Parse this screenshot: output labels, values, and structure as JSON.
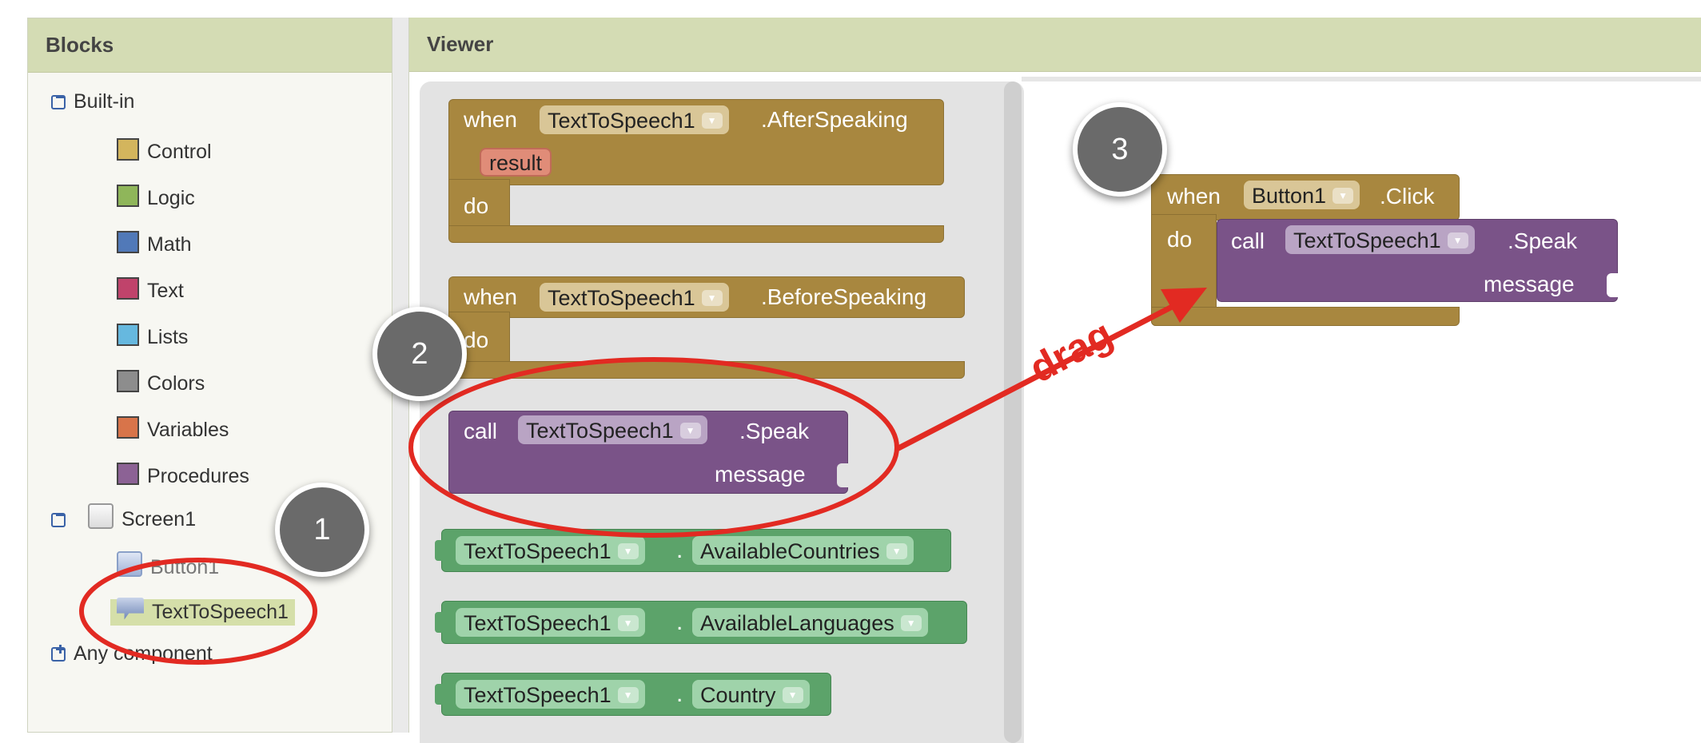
{
  "blocks_panel": {
    "title": "Blocks",
    "builtin": {
      "label": "Built-in",
      "toggle": "⊟",
      "items": [
        {
          "label": "Control",
          "color": "#d3b55d"
        },
        {
          "label": "Logic",
          "color": "#8fb65a"
        },
        {
          "label": "Math",
          "color": "#5179b8"
        },
        {
          "label": "Text",
          "color": "#c0436b"
        },
        {
          "label": "Lists",
          "color": "#66b8df"
        },
        {
          "label": "Colors",
          "color": "#8d8d8d"
        },
        {
          "label": "Variables",
          "color": "#d8744a"
        },
        {
          "label": "Procedures",
          "color": "#8c6295"
        }
      ]
    },
    "screen": {
      "label": "Screen1",
      "toggle": "⊟",
      "components": [
        "Button1",
        "TextToSpeech1"
      ]
    },
    "any_component": {
      "label": "Any component",
      "toggle": "⊞"
    }
  },
  "viewer": {
    "title": "Viewer",
    "after_speaking": {
      "when": "when",
      "component": "TextToSpeech1",
      "event": ".AfterSpeaking",
      "param": "result",
      "do": "do"
    },
    "before_speaking": {
      "when": "when",
      "component": "TextToSpeech1",
      "event": ".BeforeSpeaking",
      "do": "do"
    },
    "speak_call": {
      "call": "call",
      "component": "TextToSpeech1",
      "method": ".Speak",
      "message": "message"
    },
    "property_blocks": [
      {
        "component": "TextToSpeech1",
        "dot": ".",
        "property": "AvailableCountries"
      },
      {
        "component": "TextToSpeech1",
        "dot": ".",
        "property": "AvailableLanguages"
      },
      {
        "component": "TextToSpeech1",
        "dot": ".",
        "property": "Country"
      }
    ],
    "workspace_block": {
      "when": "when",
      "component": "Button1",
      "event": ".Click",
      "do": "do",
      "call": {
        "call": "call",
        "component": "TextToSpeech1",
        "method": ".Speak",
        "message": "message"
      }
    }
  },
  "annotations": {
    "badges": [
      "1",
      "2",
      "3"
    ],
    "drag_label": "drag",
    "highlight_color": "#e22a22"
  }
}
